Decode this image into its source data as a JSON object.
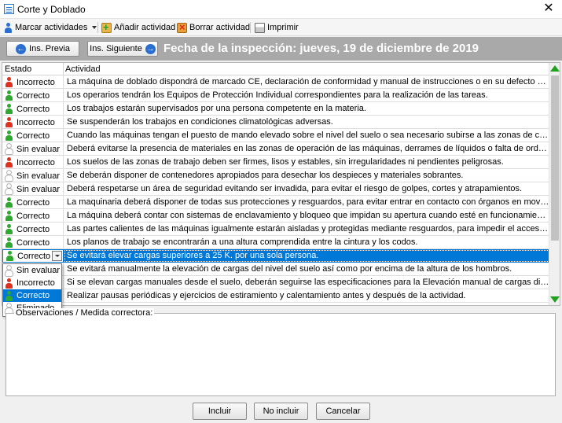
{
  "window": {
    "title": "Corte y Doblado",
    "close_glyph": "✕"
  },
  "toolbar": {
    "mark_label": "Marcar actividades",
    "add_label": "Añadir actividad",
    "delete_label": "Borrar actividad",
    "print_label": "Imprimir"
  },
  "banner": {
    "prev_label": "Ins. Previa",
    "next_label": "Ins. Siguiente",
    "date_text": "Fecha de la inspección:  jueves, 19 de diciembre de 2019"
  },
  "grid": {
    "col_status": "Estado",
    "col_activity": "Actividad",
    "rows": [
      {
        "status": "Incorrecto",
        "activity": "La máquina de doblado dispondrá de marcado CE, declaración de conformidad y manual de instrucciones o en su defecto se habrá someti"
      },
      {
        "status": "Correcto",
        "activity": "Los operarios tendrán los Equipos de Protección Individual correspondientes para la realización de las tareas."
      },
      {
        "status": "Correcto",
        "activity": "Los trabajos estarán supervisados por una persona competente en la materia."
      },
      {
        "status": "Incorrecto",
        "activity": "Se suspenderán los trabajos en condiciones climatológicas adversas."
      },
      {
        "status": "Correcto",
        "activity": "Cuando las máquinas tengan el puesto de mando elevado sobre el nivel del suelo o sea necesario subirse a las zonas de carga para realiz"
      },
      {
        "status": "Sin evaluar",
        "activity": "Deberá evitarse la presencia de materiales en las zonas de operación de las máquinas, derrames de líquidos o falta de orden y limpieza."
      },
      {
        "status": "Incorrecto",
        "activity": "Los suelos de las zonas de trabajo deben ser firmes, lisos y estables, sin irregularidades ni pendientes peligrosas."
      },
      {
        "status": "Sin evaluar",
        "activity": "Se deberán disponer de contenedores apropiados para desechar los despieces y materiales sobrantes."
      },
      {
        "status": "Sin evaluar",
        "activity": "Deberá respetarse un área de seguridad evitando ser invadida, para evitar el riesgo de golpes, cortes y atrapamientos."
      },
      {
        "status": "Correcto",
        "activity": "La maquinaria deberá disponer de todas sus protecciones y resguardos, para evitar entrar en contacto con órganos en movimiento de la m"
      },
      {
        "status": "Correcto",
        "activity": "La máquina deberá contar con sistemas de enclavamiento y bloqueo que impidan su apertura cuando esté en funcionamiento."
      },
      {
        "status": "Correcto",
        "activity": "Las partes calientes de las máquinas igualmente estarán aisladas y protegidas mediante resguardos, para impedir el acceso a las mismas."
      },
      {
        "status": "Correcto",
        "activity": "Los planos de trabajo se encontrarán a una altura comprendida entre la cintura y los codos."
      },
      {
        "status": "Correcto",
        "activity": "Se evitará elevar cargas superiores a 25 K. por una sola persona."
      },
      {
        "status": "",
        "activity": "Se evitará manualmente la elevación de cargas del nivel del suelo así como por encima de la altura de los hombros."
      },
      {
        "status": "",
        "activity": "Si se elevan cargas manuales desde el suelo, deberán seguirse las especificaciones para la Elevación manual de cargas dispuestas en el m"
      },
      {
        "status": "",
        "activity": "Realizar pausas periódicas y ejercicios de estiramiento y calentamiento antes y después de la actividad."
      }
    ]
  },
  "dropdown": {
    "options": [
      "Sin evaluar",
      "Incorrecto",
      "Correcto",
      "Eliminado"
    ]
  },
  "observations": {
    "label": "Observaciones / Medida correctora:"
  },
  "buttons": {
    "include": "Incluir",
    "exclude": "No incluir",
    "cancel": "Cancelar"
  },
  "colors": {
    "correcto": "#2ea82e",
    "incorrecto": "#e0301e",
    "sin_evaluar": "#ffffff",
    "eliminado": "#ffffff",
    "selection": "#0078d7",
    "banner_bg": "#a9a9a9"
  }
}
